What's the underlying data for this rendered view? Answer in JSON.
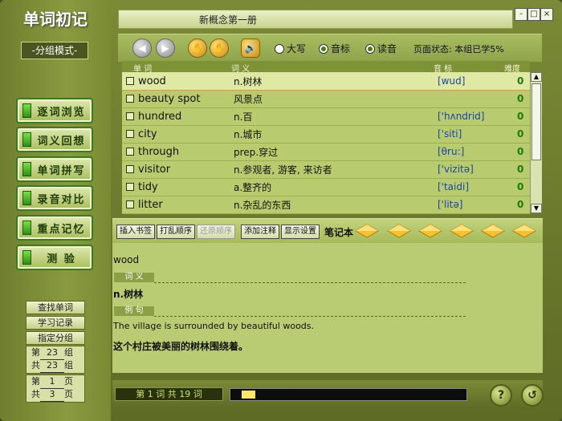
{
  "app": {
    "title": "单词初记",
    "mode": "-分组模式-"
  },
  "window": {
    "book_title": "新概念第一册",
    "min": "-",
    "max": "□",
    "close": "×"
  },
  "nav": [
    "逐词浏览",
    "词义回想",
    "单词拼写",
    "录音对比",
    "重点记忆",
    "测 验"
  ],
  "side_buttons": [
    "查找单词",
    "学习记录",
    "指定分组"
  ],
  "group_pager": {
    "cur_pre": "第",
    "cur": "23",
    "cur_unit": "组",
    "tot_pre": "共",
    "tot": "23",
    "tot_unit": "组"
  },
  "page_pager": {
    "cur_pre": "第",
    "cur": "1",
    "cur_unit": "页",
    "tot_pre": "共",
    "tot": "3",
    "tot_unit": "页"
  },
  "toolbar": {
    "back": "◀",
    "forward": "▶",
    "hand1": "✋",
    "hand2": "✋",
    "speaker": "🔊",
    "opt_upper": "大写",
    "opt_phonetic": "音标",
    "opt_read": "读音",
    "status": "页面状态: 本组已学5%"
  },
  "list_headers": {
    "word": "单 词",
    "meaning": "词 义",
    "phonetic": "音 标",
    "difficulty": "难度"
  },
  "words": [
    {
      "word": "wood",
      "meaning": "n.树林",
      "phonetic": "[wud]",
      "difficulty": "0"
    },
    {
      "word": "beauty spot",
      "meaning": "风景点",
      "phonetic": "",
      "difficulty": "0"
    },
    {
      "word": "hundred",
      "meaning": "n.百",
      "phonetic": "['hʌndrid]",
      "difficulty": "0"
    },
    {
      "word": "city",
      "meaning": "n.城市",
      "phonetic": "['siti]",
      "difficulty": "0"
    },
    {
      "word": "through",
      "meaning": "prep.穿过",
      "phonetic": "[θru:]",
      "difficulty": "0"
    },
    {
      "word": "visitor",
      "meaning": "n.参观者, 游客, 来访者",
      "phonetic": "['vizitə]",
      "difficulty": "0"
    },
    {
      "word": "tidy",
      "meaning": "a.整齐的",
      "phonetic": "['taidi]",
      "difficulty": "0"
    },
    {
      "word": "litter",
      "meaning": "n.杂乱的东西",
      "phonetic": "['litə]",
      "difficulty": "0"
    }
  ],
  "notebar": {
    "insert_bookmark": "插入书签",
    "shuffle": "打乱顺序",
    "restore": "还原顺序",
    "add_note": "添加注释",
    "display_settings": "显示设置",
    "notebook": "笔记本"
  },
  "detail": {
    "word": "wood",
    "meaning_label": "词 义",
    "meaning": "n.树林",
    "example_label": "例 句",
    "example_en": "The village is surrounded by beautiful woods.",
    "example_zh": "这个村庄被美丽的树林围绕着。"
  },
  "bottom": {
    "count": "第 1 词  共 19 词",
    "progress": 0.06,
    "help": "?",
    "back": "↺"
  },
  "colors": {
    "accent": "#8ba044",
    "phonetic": "#1b44a8",
    "difficulty": "#1d7a0a"
  }
}
